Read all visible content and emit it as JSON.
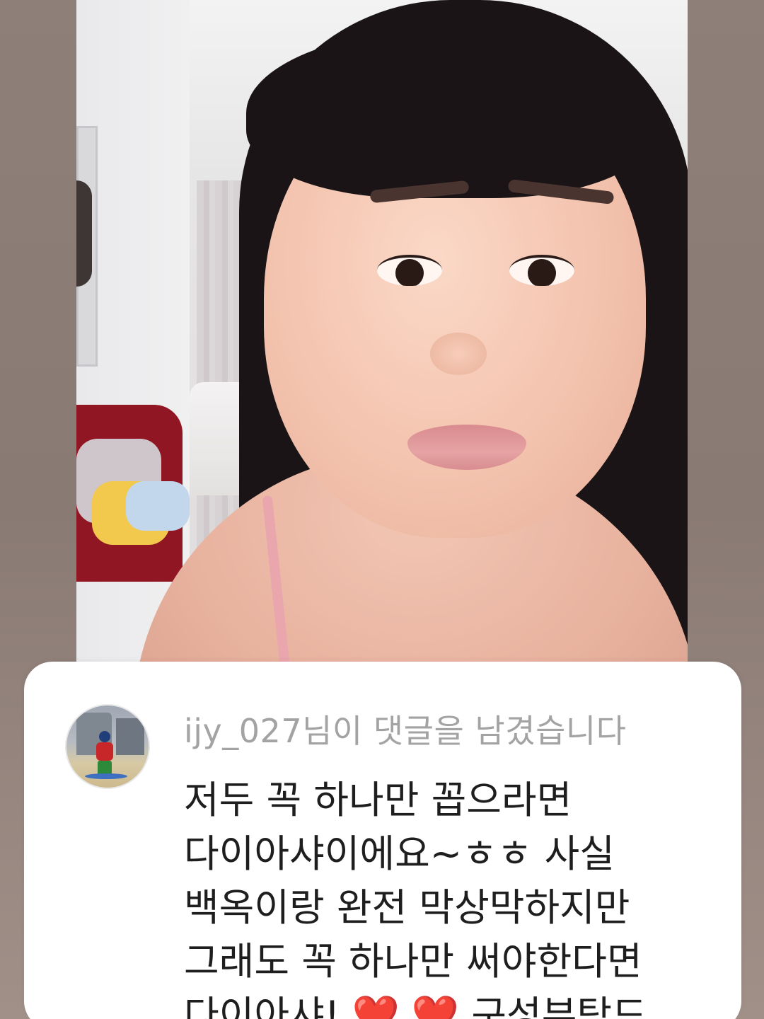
{
  "comment_notification": {
    "notice": "ijy_027님이 댓글을 남겼습니다",
    "comment_lines": [
      "저두 꼭 하나만 꼽으라면",
      "다이아샤이에요~ㅎㅎ 사실",
      "백옥이랑 완전 막상막하지만",
      "그래도 꼭 하나만 써야한다면",
      "다이아샤! ❤️ ❤️ 구성부탁드…"
    ]
  },
  "colors": {
    "card_background": "#ffffff",
    "notice_text": "#a3a3a3",
    "comment_text": "#1e1e1e",
    "frame_background": "#8e7f78"
  }
}
